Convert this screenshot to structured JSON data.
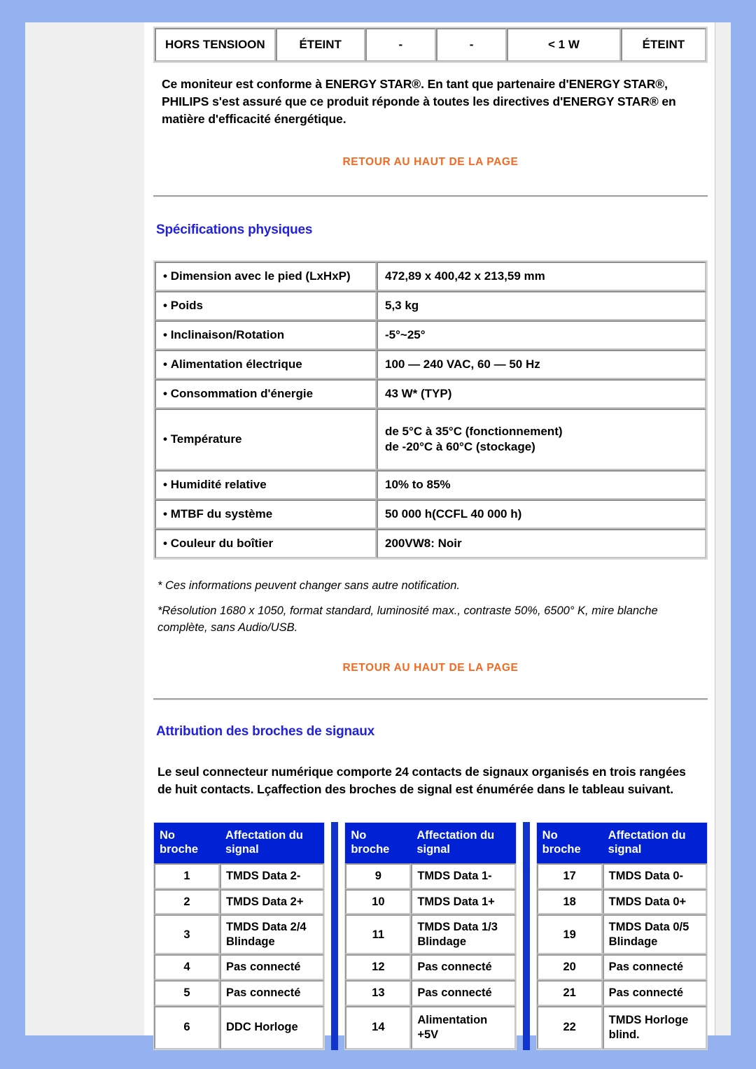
{
  "power_table": {
    "row": [
      "HORS TENSIOON",
      "ÉTEINT",
      "-",
      "-",
      "< 1 W",
      "ÉTEINT"
    ]
  },
  "energy_star": {
    "paragraph": "Ce moniteur est conforme à ENERGY STAR®. En tant que partenaire d'ENERGY STAR®, PHILIPS s'est assuré que ce produit réponde à toutes les directives d'ENERGY STAR® en matière d'efficacité énergétique."
  },
  "back_links": {
    "top": "RETOUR AU HAUT DE LA PAGE",
    "mid": "RETOUR AU HAUT DE LA PAGE"
  },
  "physical": {
    "heading": "Spécifications physiques",
    "rows": [
      {
        "label": "Dimension avec le pied (LxHxP)",
        "value": "472,89 x 400,42 x 213,59 mm"
      },
      {
        "label": "Poids",
        "value": "5,3 kg"
      },
      {
        "label": "Inclinaison/Rotation",
        "value": "-5°~25°"
      },
      {
        "label": "Alimentation électrique",
        "value": "100 — 240 VAC, 60 — 50 Hz"
      },
      {
        "label": "Consommation d'énergie",
        "value": "43 W* (TYP)"
      },
      {
        "label": "Température",
        "value": "de 5°C à 35°C (fonctionnement)\nde -20°C à 60°C (stockage)"
      },
      {
        "label": "Humidité relative",
        "value": "10% to 85%"
      },
      {
        "label": "MTBF du système",
        "value": "50 000 h(CCFL 40 000 h)"
      },
      {
        "label": "Couleur du boîtier",
        "value": "200VW8: Noir"
      }
    ],
    "note1": "* Ces informations peuvent changer sans autre notification.",
    "note2": "*Résolution 1680 x 1050, format standard, luminosité max., contraste 50%, 6500° K, mire blanche complète, sans Audio/USB."
  },
  "pins": {
    "heading": "Attribution des broches de signaux",
    "paragraph": "Le seul connecteur numérique comporte 24 contacts de signaux organisés en trois rangées de huit contacts. Lçaffection des broches de signal est énumérée dans le tableau suivant.",
    "header_num": "No broche",
    "header_sig": "Affectation du signal",
    "tables": [
      {
        "rows": [
          {
            "no": "1",
            "sig": "TMDS Data 2-"
          },
          {
            "no": "2",
            "sig": "TMDS Data 2+"
          },
          {
            "no": "3",
            "sig": "TMDS Data 2/4 Blindage"
          },
          {
            "no": "4",
            "sig": "Pas connecté"
          },
          {
            "no": "5",
            "sig": "Pas connecté"
          },
          {
            "no": "6",
            "sig": "DDC Horloge"
          }
        ]
      },
      {
        "rows": [
          {
            "no": "9",
            "sig": "TMDS Data 1-"
          },
          {
            "no": "10",
            "sig": "TMDS Data 1+"
          },
          {
            "no": "11",
            "sig": "TMDS Data 1/3 Blindage"
          },
          {
            "no": "12",
            "sig": "Pas connecté"
          },
          {
            "no": "13",
            "sig": "Pas connecté"
          },
          {
            "no": "14",
            "sig": "Alimentation +5V"
          }
        ]
      },
      {
        "rows": [
          {
            "no": "17",
            "sig": "TMDS Data 0-"
          },
          {
            "no": "18",
            "sig": "TMDS Data 0+"
          },
          {
            "no": "19",
            "sig": "TMDS Data 0/5 Blindage"
          },
          {
            "no": "20",
            "sig": "Pas connecté"
          },
          {
            "no": "21",
            "sig": "Pas connecté"
          },
          {
            "no": "22",
            "sig": "TMDS Horloge blind."
          }
        ]
      }
    ]
  },
  "colors": {
    "page_background": "#94b1f0",
    "heading_blue": "#2222dd",
    "link_orange": "#f26a21",
    "table_header_blue": "#0021d4",
    "separator_blue": "#1134cf",
    "rail_gray": "#efefef"
  }
}
